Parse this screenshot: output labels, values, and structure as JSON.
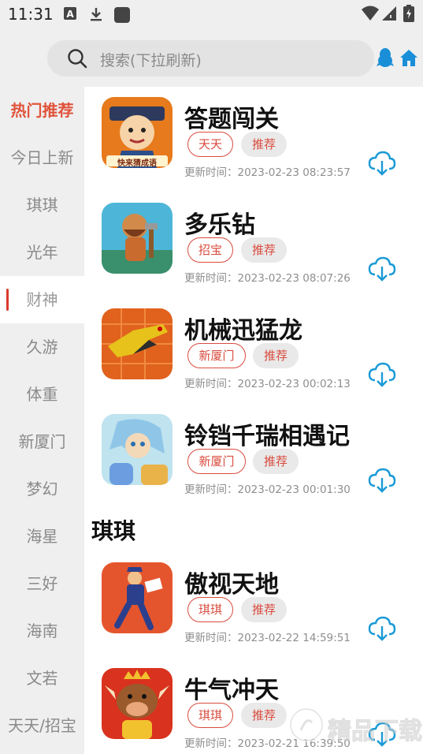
{
  "status": {
    "time": "11:31"
  },
  "search": {
    "placeholder": "搜索(下拉刷新)"
  },
  "sidebar": {
    "items": [
      {
        "label": "热门推荐"
      },
      {
        "label": "今日上新"
      },
      {
        "label": "琪琪"
      },
      {
        "label": "光年"
      },
      {
        "label": "财神"
      },
      {
        "label": "久游"
      },
      {
        "label": "体重"
      },
      {
        "label": "新厦门"
      },
      {
        "label": "梦幻"
      },
      {
        "label": "海星"
      },
      {
        "label": "三好"
      },
      {
        "label": "海南"
      },
      {
        "label": "文若"
      },
      {
        "label": "天天/招宝"
      }
    ]
  },
  "apps": [
    {
      "name": "答题闯关",
      "tag": "天天",
      "tag2": "推荐",
      "date": "更新时间：2023-02-23 08:23:57",
      "icon_text": "快来猜成语"
    },
    {
      "name": "多乐钻",
      "tag": "招宝",
      "tag2": "推荐",
      "date": "更新时间：2023-02-23 08:07:26"
    },
    {
      "name": "机械迅猛龙",
      "tag": "新厦门",
      "tag2": "推荐",
      "date": "更新时间：2023-02-23 00:02:13"
    },
    {
      "name": "铃铛千瑞相遇记",
      "tag": "新厦门",
      "tag2": "推荐",
      "date": "更新时间：2023-02-23 00:01:30"
    },
    {
      "name": "傲视天地",
      "tag": "琪琪",
      "tag2": "推荐",
      "date": "更新时间：2023-02-22 14:59:51"
    },
    {
      "name": "牛气冲天",
      "tag": "琪琪",
      "tag2": "推荐",
      "date": "更新时间：2023-02-21 16:39:50"
    }
  ],
  "section": {
    "title": "琪琪"
  },
  "watermark": {
    "text": "精品下载"
  },
  "colors": {
    "accent": "#d94b3e",
    "link_blue": "#1a8fd8",
    "hot": "#e0533b"
  }
}
